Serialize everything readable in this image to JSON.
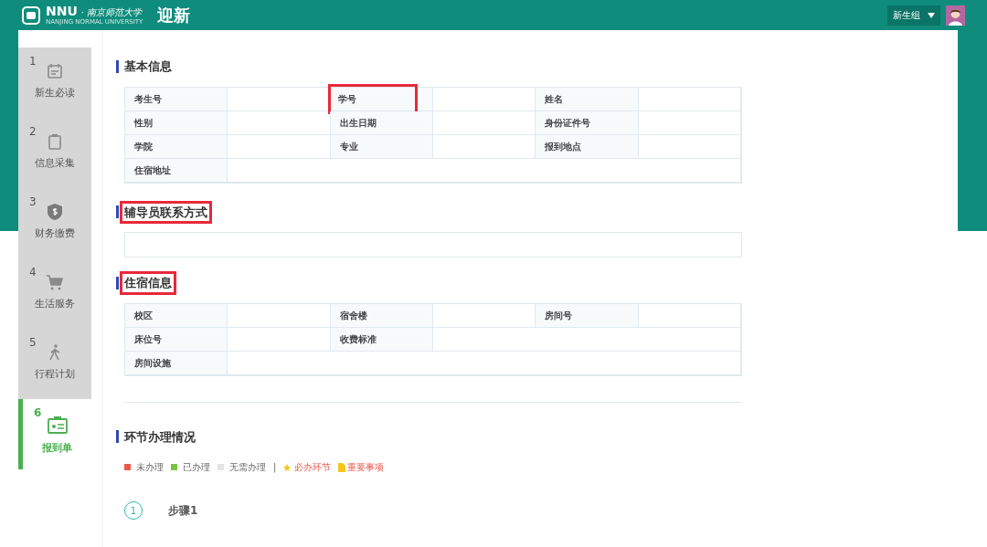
{
  "header": {
    "brand": "NNU",
    "brand_cn": "· 南京师范大学",
    "brand_en": "NANJING NORMAL UNIVERSITY",
    "title": "迎新",
    "user_group": "新生组"
  },
  "sidebar": {
    "items": [
      {
        "number": "1",
        "label": "新生必读",
        "selected": false
      },
      {
        "number": "2",
        "label": "信息采集",
        "selected": false
      },
      {
        "number": "3",
        "label": "财务缴费",
        "selected": false
      },
      {
        "number": "4",
        "label": "生活服务",
        "selected": false
      },
      {
        "number": "5",
        "label": "行程计划",
        "selected": false
      },
      {
        "number": "6",
        "label": "报到单",
        "selected": true
      }
    ]
  },
  "sections": [
    {
      "title": "基本信息",
      "highlighted": false,
      "rows": [
        [
          {
            "label": "考生号",
            "highlighted": false
          },
          {
            "label": "学号",
            "highlighted": true
          },
          {
            "label": "姓名",
            "highlighted": false
          }
        ],
        [
          {
            "label": "性别",
            "highlighted": false
          },
          {
            "label": "出生日期",
            "highlighted": false
          },
          {
            "label": "身份证件号",
            "highlighted": false
          }
        ],
        [
          {
            "label": "学院",
            "highlighted": false
          },
          {
            "label": "专业",
            "highlighted": false
          },
          {
            "label": "报到地点",
            "highlighted": false
          }
        ],
        [
          {
            "label": "住宿地址",
            "highlighted": false
          }
        ]
      ]
    },
    {
      "title": "辅导员联系方式",
      "highlighted": true,
      "rows": [
        []
      ]
    },
    {
      "title": "住宿信息",
      "highlighted": true,
      "rows": [
        [
          {
            "label": "校区",
            "highlighted": false
          },
          {
            "label": "宿舍楼",
            "highlighted": false
          },
          {
            "label": "房间号",
            "highlighted": false
          }
        ],
        [
          {
            "label": "床位号",
            "highlighted": false
          },
          {
            "label": "收费标准",
            "highlighted": false
          }
        ],
        [
          {
            "label": "房间设施",
            "highlighted": false
          }
        ]
      ]
    }
  ],
  "progress": {
    "title": "环节办理情况",
    "legend": [
      {
        "kind": "swatch",
        "label": "未办理",
        "color": "#e8594a"
      },
      {
        "kind": "swatch",
        "label": "已办理",
        "color": "#7cc142"
      },
      {
        "kind": "swatch",
        "label": "无需办理",
        "color": "#e4e4e4"
      },
      {
        "kind": "separator",
        "label": "|"
      },
      {
        "kind": "star",
        "label": "必办环节"
      },
      {
        "kind": "doc",
        "label": "重要事项"
      }
    ],
    "steps": [
      {
        "number": "1",
        "label": "步骤1"
      }
    ]
  }
}
